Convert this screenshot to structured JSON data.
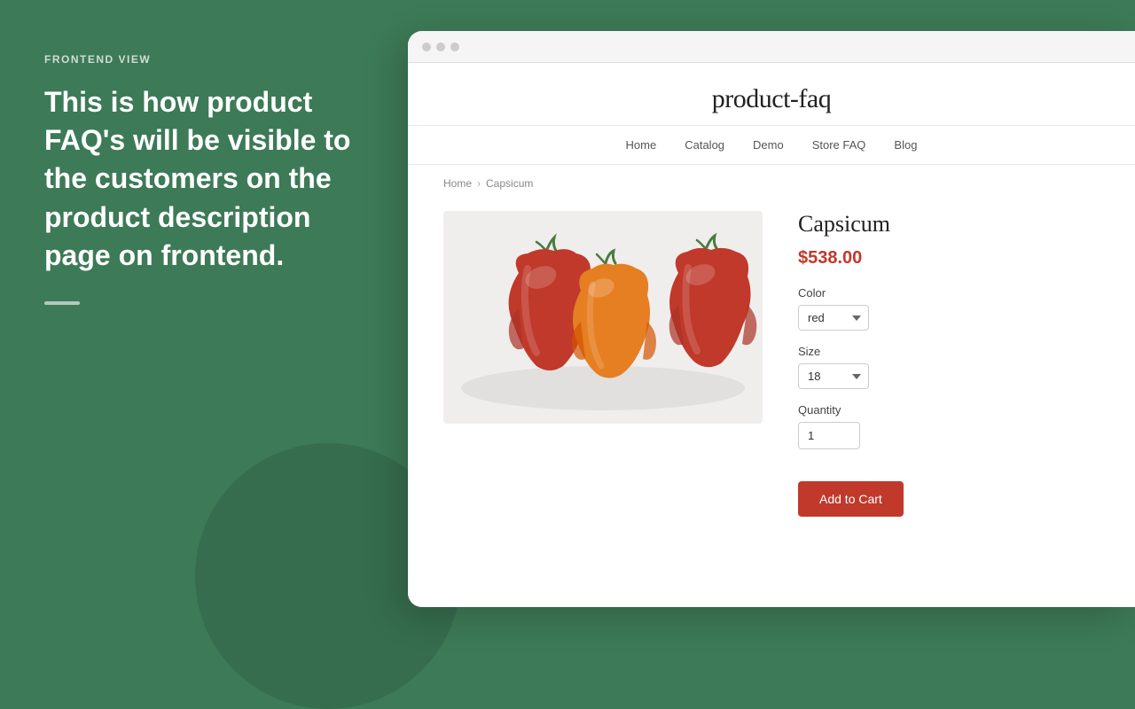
{
  "left": {
    "label": "FRONTEND VIEW",
    "description": "This is how product FAQ's will be visible to the customers on the product description page on frontend.",
    "accent": true
  },
  "browser": {
    "store_title": "product-faq",
    "nav": {
      "items": [
        {
          "label": "Home",
          "id": "home"
        },
        {
          "label": "Catalog",
          "id": "catalog"
        },
        {
          "label": "Demo",
          "id": "demo"
        },
        {
          "label": "Store FAQ",
          "id": "store-faq"
        },
        {
          "label": "Blog",
          "id": "blog"
        }
      ]
    },
    "breadcrumb": {
      "home": "Home",
      "separator": ">",
      "current": "Capsicum"
    },
    "product": {
      "name": "Capsicum",
      "price": "$538.00",
      "color_label": "Color",
      "color_value": "red",
      "size_label": "Size",
      "size_value": "18",
      "quantity_label": "Quantity",
      "quantity_value": "1",
      "add_to_cart": "Add to Cart"
    }
  }
}
